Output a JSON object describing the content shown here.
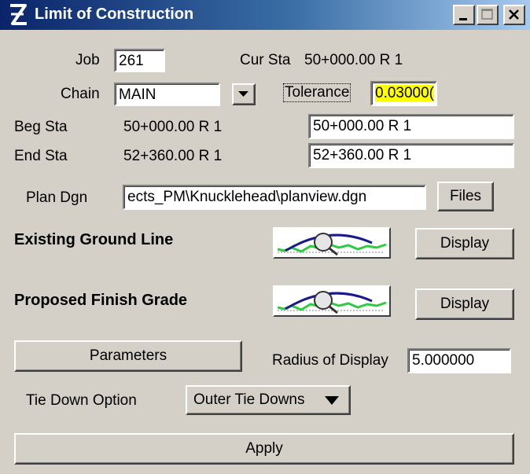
{
  "window": {
    "title": "Limit of Construction"
  },
  "job": {
    "label": "Job",
    "value": "261"
  },
  "cur_sta": {
    "label": "Cur Sta",
    "value": "50+000.00 R 1"
  },
  "chain": {
    "label": "Chain",
    "value": "MAIN"
  },
  "tolerance": {
    "label": "Tolerance",
    "value": "0.03000("
  },
  "beg_sta": {
    "label": "Beg Sta",
    "value": "50+000.00 R 1",
    "input": "50+000.00 R 1"
  },
  "end_sta": {
    "label": "End Sta",
    "value": "52+360.00 R 1",
    "input": "52+360.00 R 1"
  },
  "plan_dgn": {
    "label": "Plan Dgn",
    "value": "ects_PM\\Knucklehead\\planview.dgn",
    "files_label": "Files"
  },
  "existing_ground": {
    "label": "Existing Ground Line",
    "display_label": "Display"
  },
  "proposed_grade": {
    "label": "Proposed Finish Grade",
    "display_label": "Display"
  },
  "parameters_label": "Parameters",
  "radius": {
    "label": "Radius of Display",
    "value": "5.000000"
  },
  "tie_down": {
    "label": "Tie Down Option",
    "value": "Outer Tie Downs"
  },
  "apply_label": "Apply",
  "colors": {
    "highlight": "#ffff00",
    "title_start": "#0a246a",
    "title_end": "#a6caf0"
  }
}
